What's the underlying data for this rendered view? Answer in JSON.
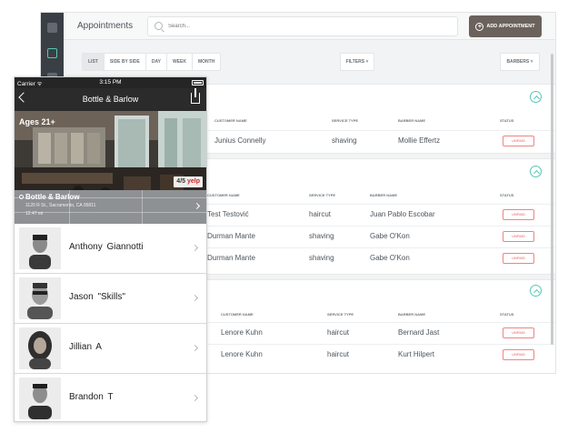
{
  "desktop": {
    "page_title": "Appointments",
    "search_placeholder": "Search...",
    "add_button": "ADD APPOINTMENT",
    "view_tabs": [
      "LIST",
      "SIDE BY SIDE",
      "DAY",
      "WEEK",
      "MONTH"
    ],
    "selected_view": "LIST",
    "filters_label": "FILTERS",
    "barbers_label": "BARBERS",
    "columns": {
      "customer": "CUSTOMER NAME",
      "service": "SERVICE TYPE",
      "barber": "BARBER NAME",
      "status": "STATUS"
    },
    "groups": [
      {
        "rows": [
          {
            "customer": "Junius Connelly",
            "service": "shaving",
            "barber": "Mollie Effertz",
            "status": "UNPAID"
          }
        ]
      },
      {
        "rows": [
          {
            "customer": "Test Testović",
            "service": "haircut",
            "barber": "Juan Pablo Escobar",
            "status": "UNPAID"
          },
          {
            "customer": "Durman Mante",
            "service": "shaving",
            "barber": "Gabe O'Kon",
            "status": "UNPAID"
          },
          {
            "customer": "Durman Mante",
            "service": "shaving",
            "barber": "Gabe O'Kon",
            "status": "UNPAID"
          }
        ]
      },
      {
        "rows": [
          {
            "customer": "Lenore Kuhn",
            "service": "haircut",
            "barber": "Bernard Jast",
            "status": "UNPAID"
          },
          {
            "customer": "Lenore Kuhn",
            "service": "haircut",
            "barber": "Kurt Hilpert",
            "status": "UNPAID"
          }
        ]
      }
    ],
    "colors": {
      "accent": "#56c6b4",
      "unpaid": "#e26363",
      "sidebar": "#3a3f45",
      "add_button": "#6b625d"
    }
  },
  "phone": {
    "carrier": "Carrier",
    "time": "3:15 PM",
    "nav_title": "Bottle & Barlow",
    "age_label": "Ages 21+",
    "rating": "4/5",
    "rating_source": "yelp",
    "shop_name": "Bottle & Barlow",
    "address": "1120 R St., Sacramento, CA 95811",
    "distance": "12.47 mi",
    "barbers": [
      {
        "name": "Anthony  Giannotti"
      },
      {
        "name": "Jason  \"Skills\""
      },
      {
        "name": "Jillian A"
      },
      {
        "name": "Brandon  T"
      }
    ]
  }
}
